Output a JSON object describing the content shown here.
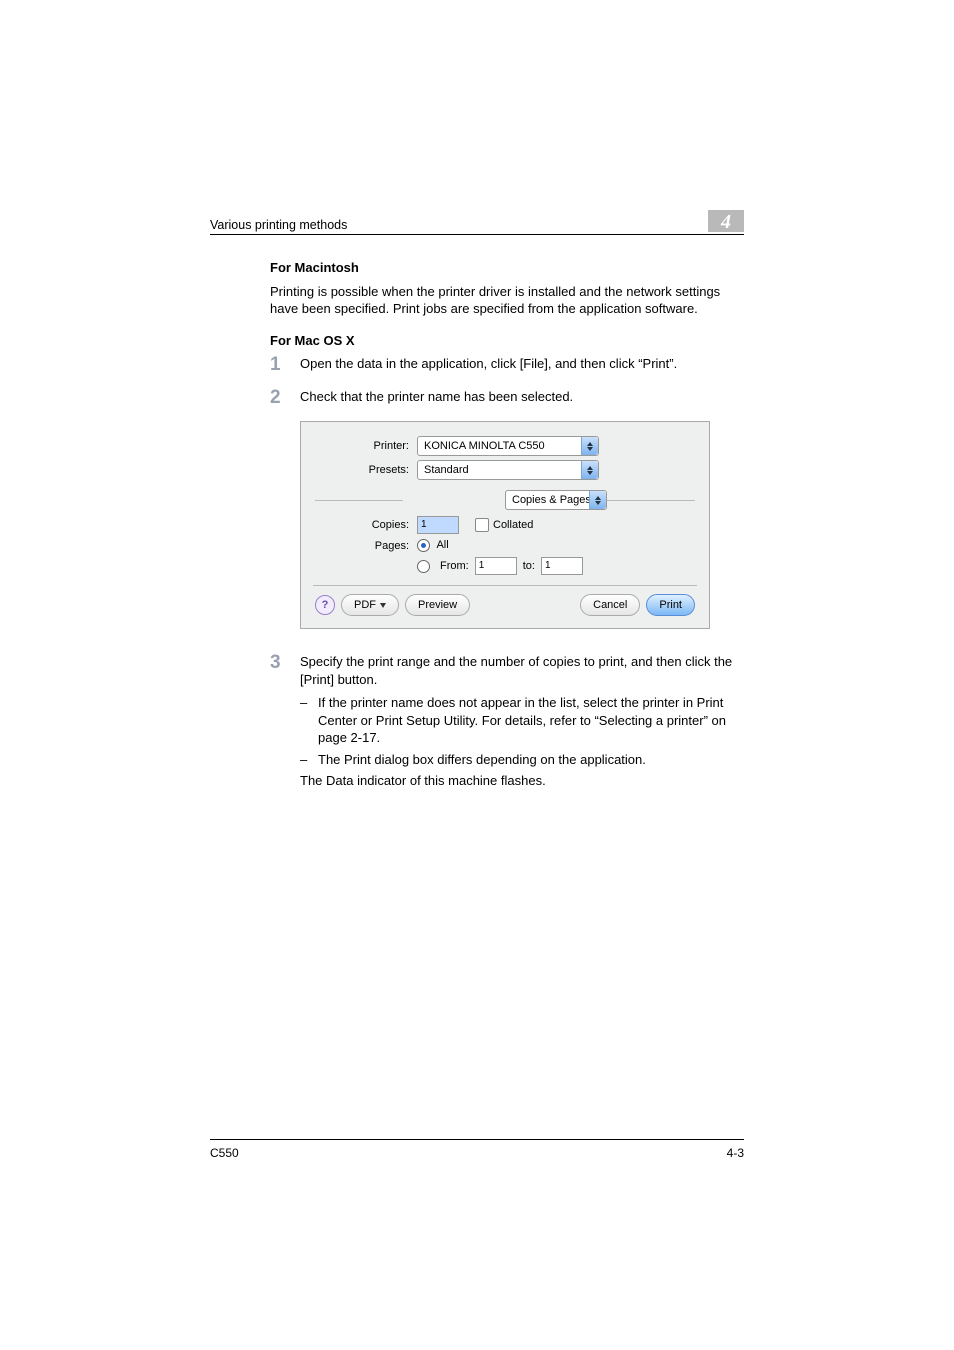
{
  "header": {
    "running_title": "Various printing methods",
    "chapter_number": "4"
  },
  "section1": {
    "heading": "For Macintosh",
    "para": "Printing is possible when the printer driver is installed and the network settings have been specified. Print jobs are specified from the application software."
  },
  "section2": {
    "heading": "For Mac OS X",
    "steps": [
      {
        "num": "1",
        "text": "Open the data in the application, click [File], and then click “Print”."
      },
      {
        "num": "2",
        "text": "Check that the printer name has been selected."
      },
      {
        "num": "3",
        "text": "Specify the print range and the number of copies to print, and then click the [Print] button.",
        "sub": [
          "If the printer name does not appear in the list, select the printer in Print Center or Print Setup Utility. For details, refer to “Selecting a printer” on page 2-17.",
          "The Print dialog box differs depending on the application."
        ],
        "tail": "The Data indicator of this machine flashes."
      }
    ]
  },
  "dialog": {
    "printer_label": "Printer:",
    "printer_value": "KONICA MINOLTA C550",
    "presets_label": "Presets:",
    "presets_value": "Standard",
    "pane_value": "Copies & Pages",
    "copies_label": "Copies:",
    "copies_value": "1",
    "collated_label": "Collated",
    "pages_label": "Pages:",
    "all_label": "All",
    "from_label": "From:",
    "from_value": "1",
    "to_label": "to:",
    "to_value": "1",
    "help_label": "?",
    "pdf_label": "PDF",
    "preview_label": "Preview",
    "cancel_label": "Cancel",
    "print_label": "Print"
  },
  "footer": {
    "model": "C550",
    "page_number": "4-3"
  }
}
